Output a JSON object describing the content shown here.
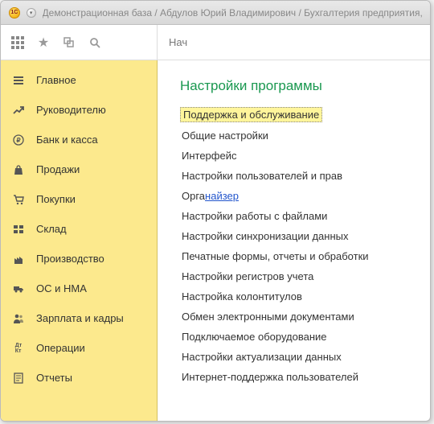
{
  "titlebar": {
    "logo_text": "1С",
    "title": "Демонстрационная база / Абдулов Юрий Владимирович / Бухгалтерия предприятия, р"
  },
  "toolbar": {
    "tab_label": "Нач"
  },
  "sidebar": {
    "items": [
      {
        "label": "Главное",
        "name": "main",
        "icon": "menu"
      },
      {
        "label": "Руководителю",
        "name": "manager",
        "icon": "chart"
      },
      {
        "label": "Банк и касса",
        "name": "bank",
        "icon": "ruble"
      },
      {
        "label": "Продажи",
        "name": "sales",
        "icon": "bag"
      },
      {
        "label": "Покупки",
        "name": "purchases",
        "icon": "cart"
      },
      {
        "label": "Склад",
        "name": "warehouse",
        "icon": "boxes"
      },
      {
        "label": "Производство",
        "name": "production",
        "icon": "factory"
      },
      {
        "label": "ОС и НМА",
        "name": "assets",
        "icon": "truck"
      },
      {
        "label": "Зарплата и кадры",
        "name": "salary",
        "icon": "people"
      },
      {
        "label": "Операции",
        "name": "operations",
        "icon": "dtkt"
      },
      {
        "label": "Отчеты",
        "name": "reports",
        "icon": "report"
      }
    ]
  },
  "main": {
    "title": "Настройки программы",
    "links": [
      {
        "label": "Поддержка и обслуживание",
        "highlighted": true
      },
      {
        "label": "Общие настройки"
      },
      {
        "label": "Интерфейс"
      },
      {
        "label": "Настройки пользователей и прав"
      },
      {
        "label_prefix": "Орга",
        "label_link": "найзер"
      },
      {
        "label": "Настройки работы с файлами"
      },
      {
        "label": "Настройки синхронизации данных"
      },
      {
        "label": "Печатные формы, отчеты и обработки"
      },
      {
        "label": "Настройки регистров учета"
      },
      {
        "label": "Настройка колонтитулов"
      },
      {
        "label": "Обмен электронными документами"
      },
      {
        "label": "Подключаемое оборудование"
      },
      {
        "label": "Настройки актуализации данных"
      },
      {
        "label": "Интернет-поддержка пользователей"
      }
    ]
  },
  "icons": {
    "menu": "≡",
    "chart": "📈",
    "ruble": "₽",
    "bag": "🛍",
    "cart": "🛒",
    "boxes": "▦",
    "factory": "🏭",
    "truck": "🚚",
    "people": "👥",
    "dtkt": "Дт\nКт",
    "report": "▤"
  }
}
